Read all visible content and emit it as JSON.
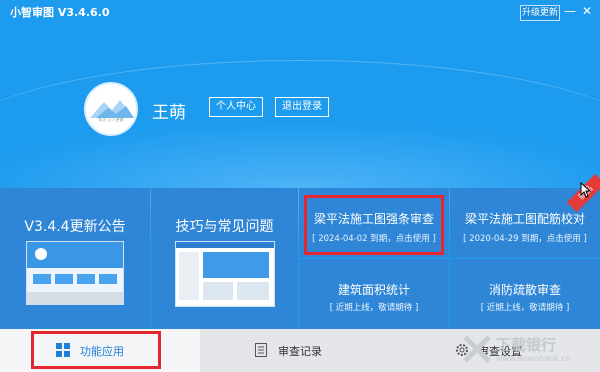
{
  "window": {
    "title": "小智审图 V3.4.6.0",
    "upgrade_label": "升级更新",
    "minimize_symbol": "—",
    "close_symbol": "✕"
  },
  "user": {
    "name": "王萌",
    "avatar_caption": "知识 让人更美",
    "profile_button": "个人中心",
    "logout_button": "退出登录"
  },
  "tiles": {
    "update_notice": {
      "title": "V3.4.4更新公告"
    },
    "tips": {
      "title": "技巧与常见问题"
    },
    "rebar_review": {
      "title": "梁平法施工图强条审查",
      "subtitle": "[ 2024-04-02 到期，点击使用 ]"
    },
    "rebar_check": {
      "title": "梁平法施工图配筋校对",
      "subtitle": "[ 2020-04-29 到期，点击使用 ]",
      "badge": "新品"
    },
    "area_stats": {
      "title": "建筑面积统计",
      "subtitle": "[ 近期上线，敬请期待 ]"
    },
    "fire_review": {
      "title": "消防疏散审查",
      "subtitle": "[ 近期上线，敬请期待 ]"
    }
  },
  "tabs": [
    {
      "label": "功能应用",
      "icon": "grid-icon",
      "selected": true
    },
    {
      "label": "审查记录",
      "icon": "document-icon",
      "selected": false
    },
    {
      "label": "审查设置",
      "icon": "gear-icon",
      "selected": false
    }
  ],
  "watermark": {
    "text": "下载银行",
    "url_text": "www.downbank.cn"
  },
  "colors": {
    "primary_blue": "#1d9bee",
    "tile_blue": "#2f86d6",
    "highlight_red": "#e3262f",
    "tab_bar": "#e4e6e9",
    "selected_tab": "#f4f5f7"
  }
}
